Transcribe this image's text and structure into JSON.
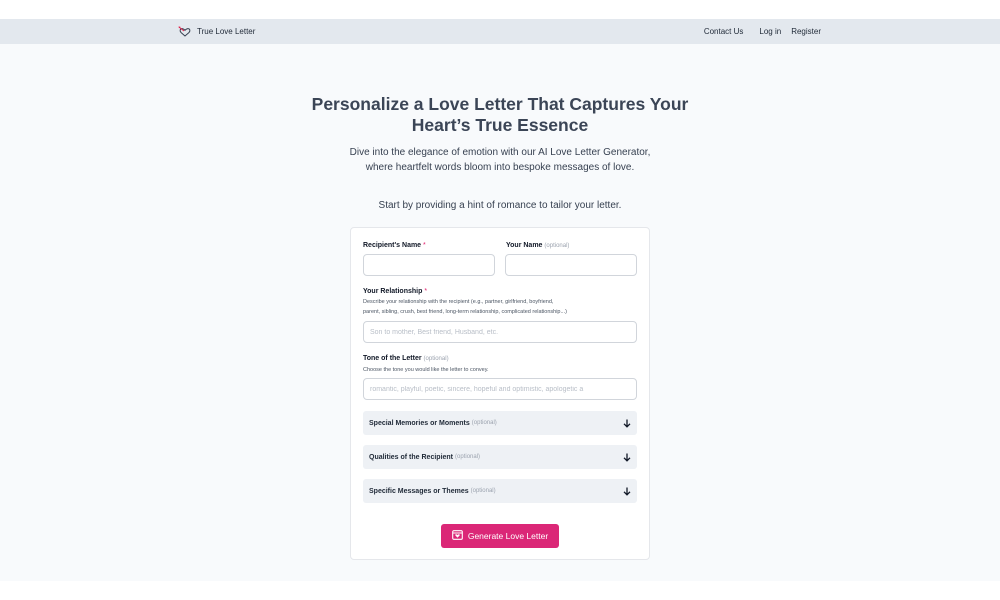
{
  "header": {
    "brand": "True Love Letter",
    "nav": {
      "contact": "Contact Us",
      "login": "Log in",
      "register": "Register"
    }
  },
  "hero": {
    "title_line1": "Personalize a Love Letter That Captures Your",
    "title_line2": "Heart’s True Essence",
    "subtitle_line1": "Dive into the elegance of emotion with our AI Love Letter Generator,",
    "subtitle_line2": "where heartfelt words bloom into bespoke messages of love.",
    "hint": "Start by providing a hint of romance to tailor your letter."
  },
  "form": {
    "recipient_name": {
      "label": "Recipient's Name",
      "required_mark": "*",
      "value": ""
    },
    "your_name": {
      "label": "Your Name",
      "optional": "(optional)",
      "value": ""
    },
    "relationship": {
      "label": "Your Relationship",
      "required_mark": "*",
      "desc_line1": "Describe your relationship with the recipient (e.g., partner, girlfriend, boyfriend,",
      "desc_line2": "parent, sibling, crush, best friend, long-term relationship, complicated relationship...)",
      "placeholder": "Son to mother, Best friend, Husband, etc."
    },
    "tone": {
      "label": "Tone of the Letter",
      "optional": "(optional)",
      "desc": "Choose the tone you would like the letter to convey.",
      "placeholder": "romantic, playful, poetic, sincere, hopeful and optimistic, apologetic a"
    },
    "accordions": [
      {
        "label": "Special Memories or Moments",
        "optional": "(optional)"
      },
      {
        "label": "Qualities of the Recipient",
        "optional": "(optional)"
      },
      {
        "label": "Specific Messages or Themes",
        "optional": "(optional)"
      }
    ],
    "submit_label": "Generate Love Letter"
  },
  "colors": {
    "accent": "#db2777",
    "topbar": "#e3e8ee",
    "page_bg": "#f8fafc"
  }
}
